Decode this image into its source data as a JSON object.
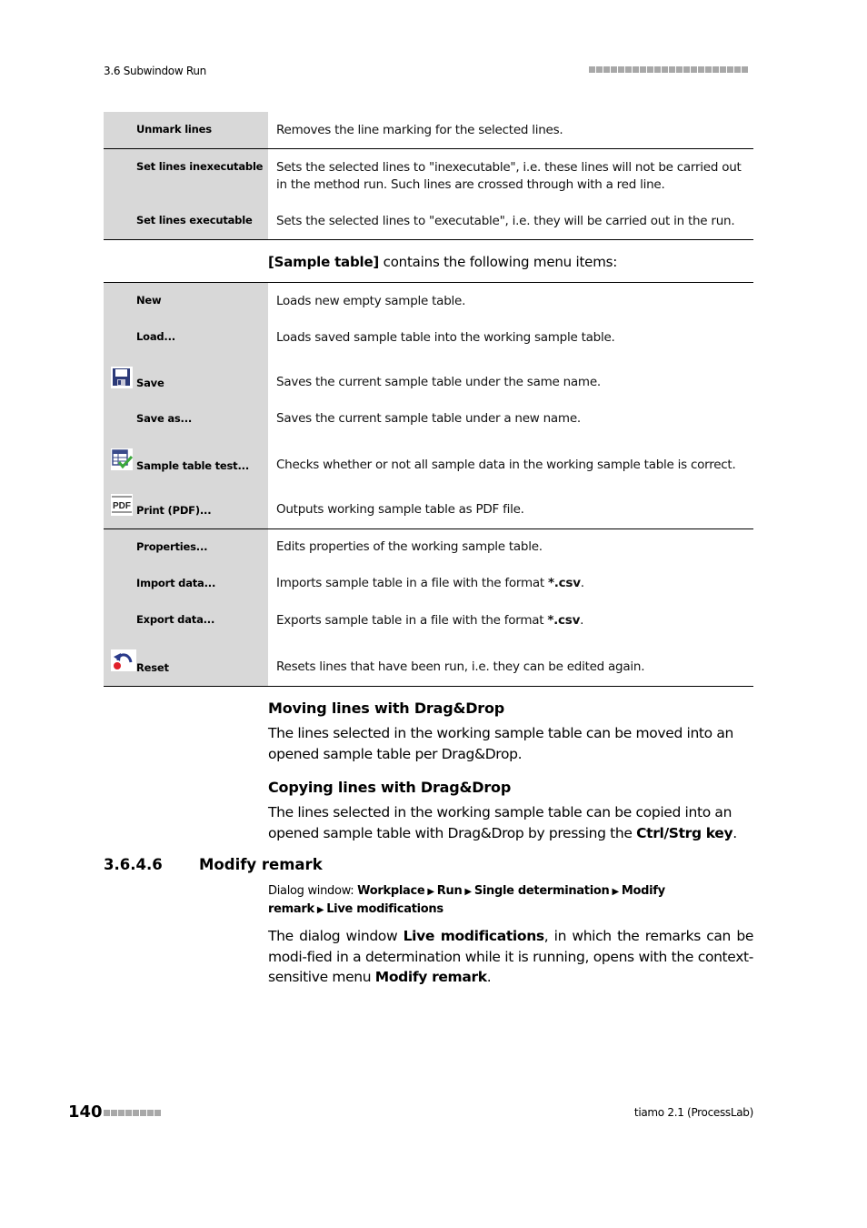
{
  "header": {
    "section": "3.6 Subwindow Run",
    "decoration_squares": 22
  },
  "table1": {
    "rows": [
      {
        "label": "Unmark lines",
        "description": "Removes the line marking for the selected lines."
      },
      {
        "label": "Set lines inexecutable",
        "description": "Sets the selected lines to \"inexecutable\", i.e. these lines will not be carried out in the method run. Such lines are crossed through with a red line."
      },
      {
        "label": "Set lines executable",
        "description": "Sets the selected lines to \"executable\", i.e. they will be carried out in the run."
      }
    ]
  },
  "intro": {
    "bold": "[Sample table]",
    "rest": " contains the following menu items:"
  },
  "table2": {
    "rows": [
      {
        "label": "New",
        "description": "Loads new empty sample table.",
        "icon": null
      },
      {
        "label": "Load...",
        "description": "Loads saved sample table into the working sample table.",
        "icon": null
      },
      {
        "label": "Save",
        "description": "Saves the current sample table under the same name.",
        "icon": "floppy-disk-icon"
      },
      {
        "label": "Save as...",
        "description": "Saves the current sample table under a new name.",
        "icon": null
      },
      {
        "label": "Sample table test...",
        "description": "Checks whether or not all sample data in the working sample table is correct.",
        "icon": "table-check-icon"
      },
      {
        "label": "Print (PDF)...",
        "description": "Outputs working sample table as PDF file.",
        "icon": "pdf-icon"
      }
    ]
  },
  "table3": {
    "rows": [
      {
        "label": "Properties...",
        "description": "Edits properties of the working sample table."
      },
      {
        "label": "Import data...",
        "description_pre": "Imports sample table in a file with the format ",
        "description_bold": "*.csv",
        "description_post": "."
      },
      {
        "label": "Export data...",
        "description_pre": "Exports sample table in a file with the format ",
        "description_bold": "*.csv",
        "description_post": "."
      },
      {
        "label": "Reset",
        "description": "Resets lines that have been run, i.e. they can be edited again.",
        "icon": "reset-icon"
      }
    ]
  },
  "moving": {
    "heading": "Moving lines with Drag&Drop",
    "text": "The lines selected in the working sample table can be moved into an opened sample table per Drag&Drop."
  },
  "copying": {
    "heading": "Copying lines with Drag&Drop",
    "text_pre": "The lines selected in the working sample table can be copied into an opened sample table with Drag&Drop by pressing the ",
    "text_bold": "Ctrl/Strg key",
    "text_post": "."
  },
  "section": {
    "number": "3.6.4.6",
    "title": "Modify remark",
    "path_label": "Dialog window: ",
    "path": [
      "Workplace",
      "Run",
      "Single determination",
      "Modify remark",
      "Live modifications"
    ],
    "para_pre": "The dialog window ",
    "para_bold1": "Live modifications",
    "para_mid": ", in which the remarks can be modi-fied in a determination while it is running, opens with the context-sensitive menu ",
    "para_bold2": "Modify remark",
    "para_post": "."
  },
  "footer": {
    "page_number": "140",
    "product": "tiamo 2.1 (ProcessLab)"
  }
}
